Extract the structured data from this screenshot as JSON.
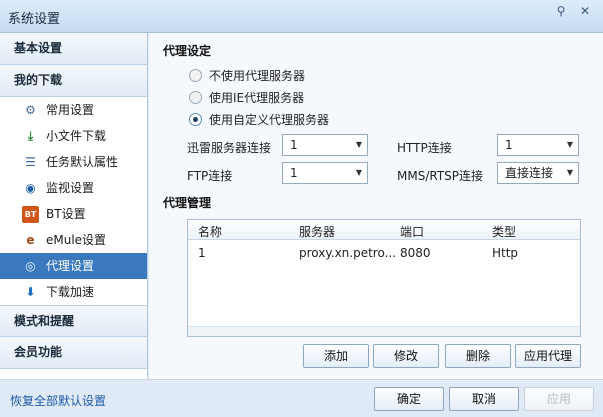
{
  "window": {
    "title": "系统设置",
    "pin_glyph": "⚲",
    "close_glyph": "✕"
  },
  "sidebar": {
    "groups": [
      {
        "label": "基本设置"
      },
      {
        "label": "我的下载"
      },
      {
        "label": "模式和提醒"
      },
      {
        "label": "会员功能"
      }
    ],
    "items": [
      {
        "label": "常用设置",
        "icon": "gear-icon"
      },
      {
        "label": "小文件下载",
        "icon": "download-arrow-icon"
      },
      {
        "label": "任务默认属性",
        "icon": "list-icon"
      },
      {
        "label": "监视设置",
        "icon": "monitor-eye-icon"
      },
      {
        "label": "BT设置",
        "icon": "bt-icon"
      },
      {
        "label": "eMule设置",
        "icon": "emule-icon"
      },
      {
        "label": "代理设置",
        "icon": "proxy-globe-icon",
        "active": true
      },
      {
        "label": "下载加速",
        "icon": "accelerate-icon"
      }
    ],
    "restore_link": "恢复全部默认设置"
  },
  "proxy_settings": {
    "title": "代理设定",
    "options": [
      {
        "label": "不使用代理服务器",
        "selected": false
      },
      {
        "label": "使用IE代理服务器",
        "selected": false
      },
      {
        "label": "使用自定义代理服务器",
        "selected": true
      }
    ],
    "fields": {
      "thunder_label": "迅雷服务器连接",
      "thunder_value": "1",
      "http_label": "HTTP连接",
      "http_value": "1",
      "ftp_label": "FTP连接",
      "ftp_value": "1",
      "mms_label": "MMS/RTSP连接",
      "mms_value": "直接连接"
    }
  },
  "proxy_management": {
    "title": "代理管理",
    "columns": [
      "名称",
      "服务器",
      "端口",
      "类型"
    ],
    "rows": [
      {
        "name": "1",
        "server": "proxy.xn.petro...",
        "port": "8080",
        "type": "Http"
      }
    ],
    "buttons": {
      "add": "添加",
      "edit": "修改",
      "delete": "删除",
      "apply": "应用代理"
    }
  },
  "footer": {
    "ok": "确定",
    "cancel": "取消",
    "apply": "应用"
  },
  "colors": {
    "accent": "#3a79bd",
    "link": "#1e5aa8",
    "background": "#dfeaf6"
  }
}
